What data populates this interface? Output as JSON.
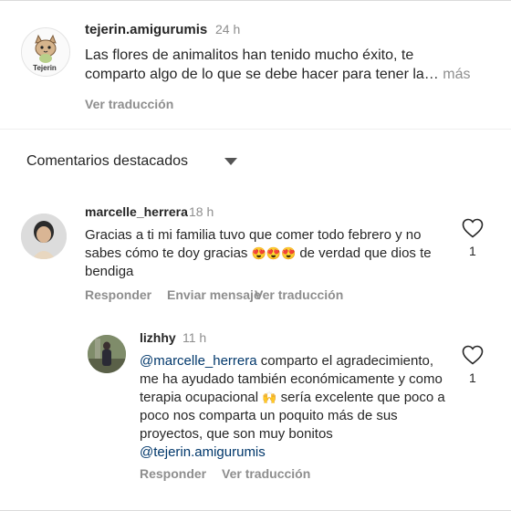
{
  "post": {
    "username": "tejerin.amigurumis",
    "time": "24 h",
    "text": "Las flores de animalitos han tenido mucho éxito, te comparto algo de lo que se debe hacer para tener la…",
    "more": "más",
    "translate": "Ver traducción",
    "avatar_label": "Tejerin"
  },
  "section": {
    "title": "Comentarios destacados"
  },
  "comments": [
    {
      "username": "marcelle_herrera",
      "time": "18 h",
      "text_before": "Gracias a ti mi familia tuvo que comer todo febrero y no sabes cómo te doy gracias ",
      "emojis": "😍😍😍",
      "text_after": " de verdad que dios te bendiga",
      "reply": "Responder",
      "send_message": "Enviar mensaje",
      "translate": "Ver traducción",
      "likes": "1"
    }
  ],
  "reply": {
    "username": "lizhhy",
    "time": "11 h",
    "mention": "@marcelle_herrera",
    "text_main": " comparto el agradecimiento, me ha ayudado también económicamente y como terapia ocupacional ",
    "emoji": "🙌",
    "text_after": " sería excelente que poco a poco nos comparta un poquito más de sus proyectos, que son muy bonitos ",
    "mention2": "@tejerin.amigurumis",
    "reply_label": "Responder",
    "translate": "Ver traducción",
    "likes": "1"
  }
}
